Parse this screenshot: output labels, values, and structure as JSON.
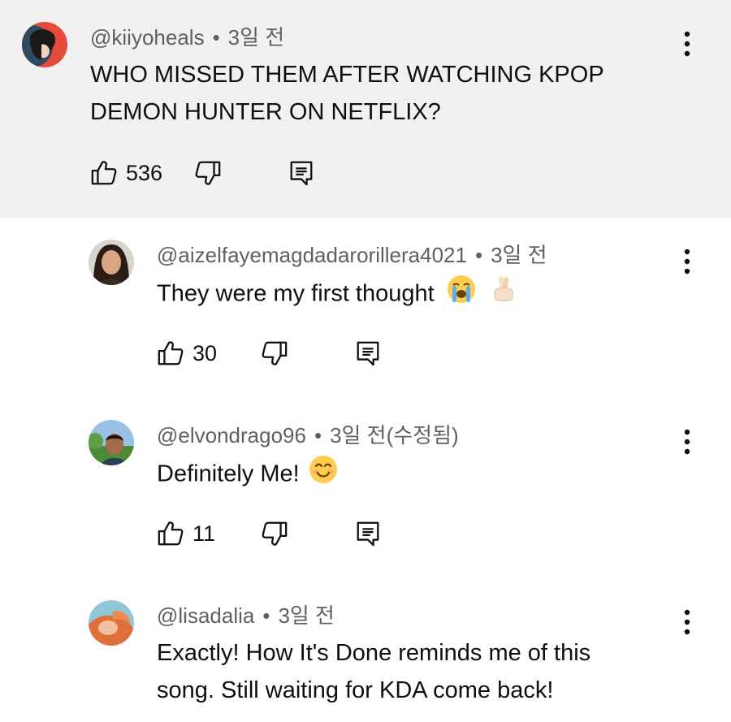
{
  "comments": [
    {
      "username": "@kiiyoheals",
      "time": "3일 전",
      "text_lines": [
        "WHO MISSED THEM AFTER WATCHING KPOP",
        "DEMON HUNTER ON NETFLIX?"
      ],
      "likes": "536"
    },
    {
      "username": "@aizelfayemagdadarorillera4021",
      "time": "3일 전",
      "text": "They were my first thought",
      "likes": "30"
    },
    {
      "username": "@elvondrago96",
      "time": "3일 전(수정됨)",
      "text": "Definitely Me!",
      "likes": "11"
    },
    {
      "username": "@lisadalia",
      "time": "3일 전",
      "text_lines": [
        "Exactly! How It's Done reminds me of this",
        "song. Still waiting for KDA come back!"
      ]
    }
  ],
  "meta_separator": "•",
  "icons": {
    "like": "thumbs-up-icon",
    "dislike": "thumbs-down-icon",
    "reply": "reply-icon",
    "menu": "more-vert-icon",
    "emoji_1": "loudly-crying-face-emoji",
    "emoji_2": "crossed-fingers-emoji",
    "emoji_3": "smiling-face-emoji"
  },
  "colors": {
    "highlight_bg": "#f1f1f1",
    "meta_text": "#606060",
    "main_text": "#0f0f0f"
  }
}
